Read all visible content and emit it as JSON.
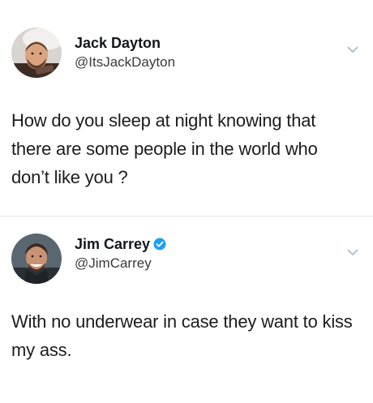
{
  "tweets": [
    {
      "display_name": "Jack Dayton",
      "handle": "@ItsJackDayton",
      "verified": false,
      "text": "How do you sleep at night knowing that there are some people in the world who don’t like you ?",
      "avatar_icon": "avatar-photo"
    },
    {
      "display_name": "Jim Carrey",
      "handle": "@JimCarrey",
      "verified": true,
      "text": "With no underwear in case they want to kiss my ass.",
      "avatar_icon": "avatar-photo"
    }
  ],
  "colors": {
    "verified_blue": "#1da1f2",
    "chevron_gray": "#aab8c2",
    "divider": "#e1e8ed"
  }
}
